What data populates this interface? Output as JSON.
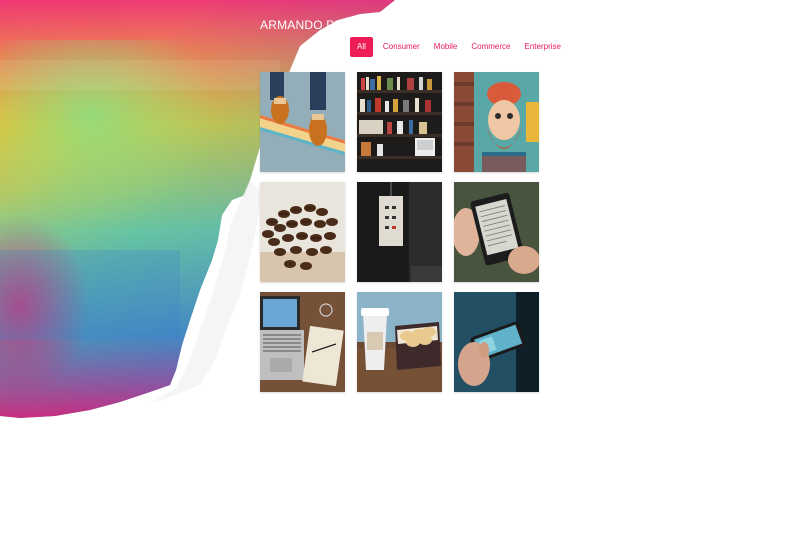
{
  "brand": {
    "name": "ARMANDO PEREZ"
  },
  "filters": [
    {
      "label": "All",
      "active": true
    },
    {
      "label": "Consumer",
      "active": false
    },
    {
      "label": "Mobile",
      "active": false
    },
    {
      "label": "Commerce",
      "active": false
    },
    {
      "label": "Enterprise",
      "active": false
    }
  ],
  "gallery": [
    {
      "subject": "skateboard-feet"
    },
    {
      "subject": "bookshelf"
    },
    {
      "subject": "bearded-man-mural"
    },
    {
      "subject": "coffee-beans"
    },
    {
      "subject": "hanging-sign"
    },
    {
      "subject": "ereader-in-hand"
    },
    {
      "subject": "laptop-and-notebook"
    },
    {
      "subject": "coffee-cup-and-cookies"
    },
    {
      "subject": "phone-in-hand"
    }
  ],
  "colors": {
    "accent": "#ee1d55",
    "filter_text": "#e6195a"
  }
}
